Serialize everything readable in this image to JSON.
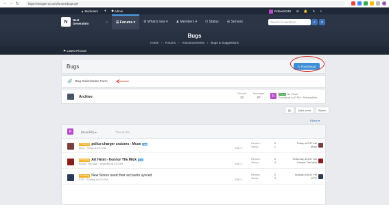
{
  "browser": {
    "url": "https://nextgen-rp.com/forums/bugs.29/"
  },
  "staff_bar": {
    "moderator_label": "Moderator",
    "admin_label": "Admin"
  },
  "nav": {
    "logo_line1": "Next",
    "logo_line2": "Generation",
    "items": [
      {
        "label": "Forums",
        "active": true
      },
      {
        "label": "What's new",
        "active": false
      },
      {
        "label": "Members",
        "active": false
      },
      {
        "label": "Status",
        "active": false
      },
      {
        "label": "Servers",
        "active": false
      }
    ],
    "username": "Robert4049",
    "search_placeholder": "Search in members..."
  },
  "hero": {
    "title": "Bugs",
    "breadcrumbs": [
      "Home",
      "Forums",
      "Announcements",
      "Bugs & Suggestions"
    ]
  },
  "pinned": {
    "label": "Latest Pinned"
  },
  "page": {
    "title": "Bugs",
    "post_thread_label": "Post thread"
  },
  "link_forum": {
    "label": "Bug Submission Form"
  },
  "archive": {
    "title": "Archive",
    "threads_label": "Threads",
    "threads_value": "32",
    "messages_label": "Messages",
    "messages_value": "87",
    "last_tag": "Fixed",
    "last_title": "No Prone",
    "last_meta": "Sunday at 4:40 PM · RobertsKidz",
    "avatar_letter": "R"
  },
  "toolbar": {
    "mark_read": "Mark read",
    "watch": "Watch"
  },
  "filters_label": "Filters",
  "new_thread": {
    "avatar_letter": "R",
    "prefix": "(No prefix)",
    "title_placeholder": "Thread title"
  },
  "threads": [
    {
      "prefix": "Pending",
      "title": "police charger cruisers - Mcoe",
      "bold": true,
      "new": true,
      "meta": "Mcoe · Today at 2:57 AM",
      "replies": "0",
      "views": "1",
      "last_time": "Today at 2:57 AM",
      "last_user": "Mcoe",
      "avatar_color": "#7a3e3e"
    },
    {
      "prefix": "Pending",
      "title": "Art Heist - Konnor The Mick",
      "bold": true,
      "new": true,
      "meta": "Konnor The Mick · Yesterday at 3:57 AM",
      "replies": "0",
      "views": "4",
      "last_time": "Yesterday at 3:57 AM",
      "last_user": "Konnor The Mick",
      "avatar_color": "#8b1c1c"
    },
    {
      "prefix": "Pending",
      "title": "New Stores need their accounts synced",
      "bold": false,
      "new": false,
      "meta": "ICR7 · Sunday at 8:22 PM",
      "replies": "0",
      "views": "3",
      "last_time": "Sunday at 8:22 PM",
      "last_user": "ICR7",
      "avatar_color": "#2b3a55"
    }
  ],
  "stat_labels": {
    "replies": "Replies:",
    "views": "Views:"
  },
  "colors": {
    "accent": "#3c8fd6",
    "annotation": "#d0221b",
    "pending": "#f0ad1e"
  }
}
